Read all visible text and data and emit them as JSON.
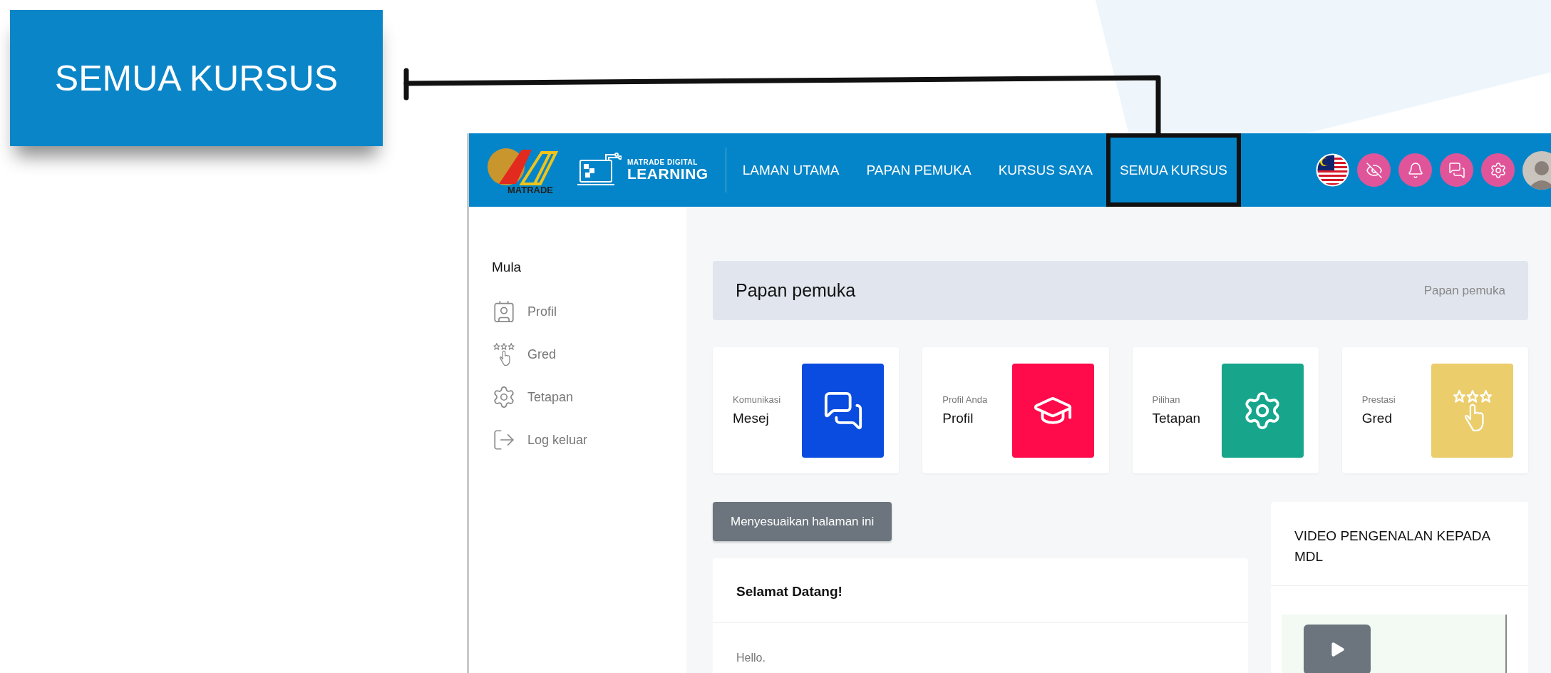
{
  "callout": {
    "label": "SEMUA KURSUS"
  },
  "header": {
    "logo_text": "MATRADE",
    "brand_line_1": "MATRADE DIGITAL",
    "brand_line_2": "LEARNING",
    "nav": [
      {
        "label": "LAMAN UTAMA",
        "highlighted": false
      },
      {
        "label": "PAPAN PEMUKA",
        "highlighted": false
      },
      {
        "label": "KURSUS SAYA",
        "highlighted": false
      },
      {
        "label": "SEMUA KURSUS",
        "highlighted": true
      }
    ]
  },
  "sidebar": {
    "heading": "Mula",
    "items": [
      {
        "label": "Profil",
        "kind": "profile"
      },
      {
        "label": "Gred",
        "kind": "grade"
      },
      {
        "label": "Tetapan",
        "kind": "settings"
      },
      {
        "label": "Log keluar",
        "kind": "logout"
      }
    ]
  },
  "page_header": {
    "title": "Papan pemuka",
    "breadcrumb": "Papan pemuka"
  },
  "cards": [
    {
      "caption": "Komunikasi",
      "title": "Mesej",
      "color": "#0a4be0",
      "kind": "messages"
    },
    {
      "caption": "Profil Anda",
      "title": "Profil",
      "color": "#ff0a4a",
      "kind": "profile"
    },
    {
      "caption": "Pilihan",
      "title": "Tetapan",
      "color": "#17a68c",
      "kind": "settings"
    },
    {
      "caption": "Prestasi",
      "title": "Gred",
      "color": "#ebcd6c",
      "kind": "grade"
    }
  ],
  "customize_button": "Menyesuaikan halaman ini",
  "welcome": {
    "title": "Selamat Datang!",
    "text": "Hello."
  },
  "video": {
    "title": "VIDEO PENGENALAN KEPADA MDL"
  }
}
